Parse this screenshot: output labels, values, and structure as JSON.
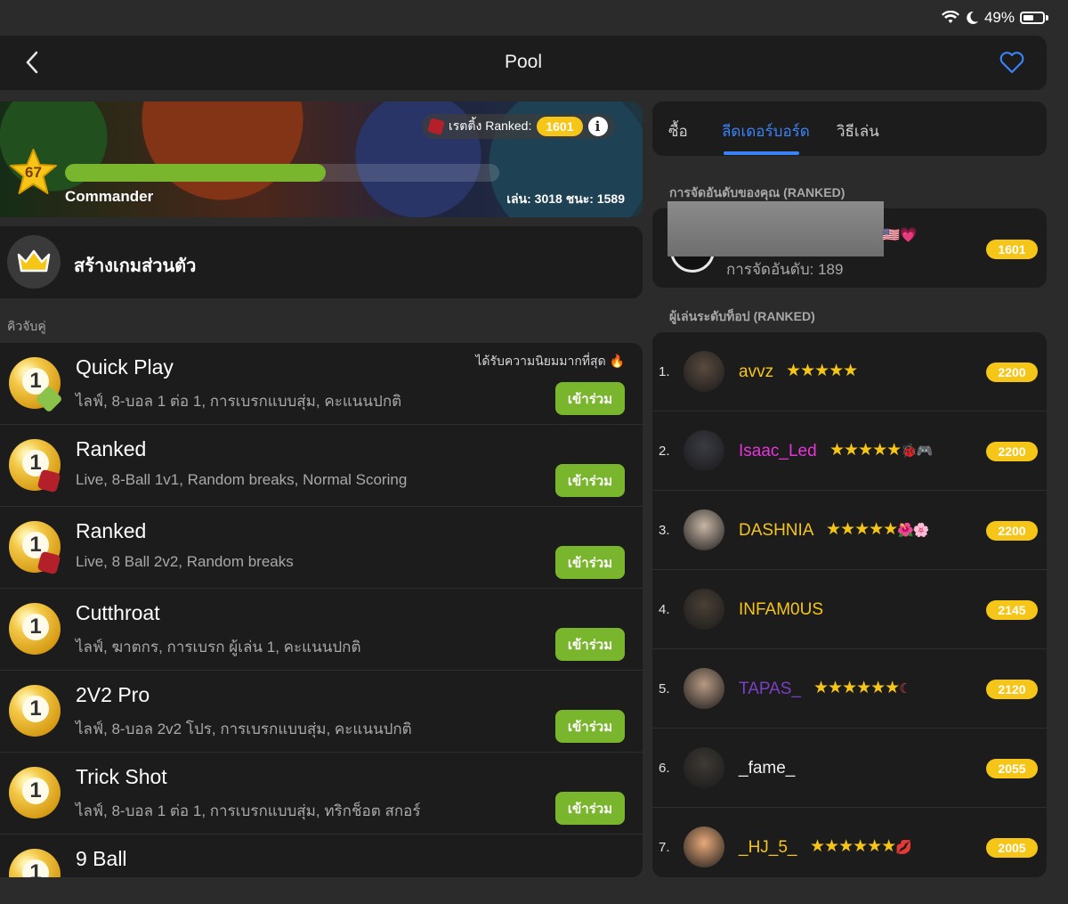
{
  "status": {
    "battery": "49%"
  },
  "header": {
    "title": "Pool"
  },
  "banner": {
    "rating_label": "เรตติ้ง Ranked:",
    "rating_value": "1601",
    "level": "67",
    "xp_progress": 0.6,
    "rank_title": "Commander",
    "stats": "เล่น: 3018 ชนะ: 1589"
  },
  "private_game": {
    "label": "สร้างเกมส่วนตัว"
  },
  "queue_heading": "คิวจับคู่",
  "games": [
    {
      "title": "Quick Play",
      "desc": "ไลฟ์, 8-บอล 1 ต่อ 1, การเบรกแบบสุ่ม, คะแนนปกติ",
      "badge": "bolt",
      "popular": "ได้รับความนิยมมากที่สุด",
      "join": "เข้าร่วม"
    },
    {
      "title": "Ranked",
      "desc": "Live, 8-Ball 1v1, Random breaks, Normal Scoring",
      "badge": "dice",
      "join": "เข้าร่วม"
    },
    {
      "title": "Ranked",
      "desc": "Live, 8 Ball 2v2, Random breaks",
      "badge": "dice",
      "join": "เข้าร่วม"
    },
    {
      "title": "Cutthroat",
      "desc": "ไลฟ์, ฆาตกร, การเบรก ผู้เล่น  1, คะแนนปกติ",
      "badge": "",
      "join": "เข้าร่วม"
    },
    {
      "title": "2V2 Pro",
      "desc": "ไลฟ์, 8-บอล 2v2 โปร, การเบรกแบบสุ่ม, คะแนนปกติ",
      "badge": "",
      "join": "เข้าร่วม"
    },
    {
      "title": "Trick Shot",
      "desc": "ไลฟ์, 8-บอล 1 ต่อ 1, การเบรกแบบสุ่ม, ทริกช็อต สกอร์",
      "badge": "",
      "join": "เข้าร่วม"
    },
    {
      "title": "9 Ball",
      "desc": "",
      "badge": "",
      "join": ""
    }
  ],
  "tabs": [
    "ซื้อ",
    "ลีดเดอร์บอร์ด",
    "วิธีเล่น"
  ],
  "my_rank": {
    "heading": "การจัดอันดับของคุณ (RANKED)",
    "rank_text": "การจัดอันดับ: 189",
    "score": "1601"
  },
  "top_heading": "ผู้เล่นระดับท็อป (RANKED)",
  "leaders": [
    {
      "rank": "1.",
      "name": "avvz",
      "color": "#f5c518",
      "stars": "★★★★★",
      "extra": "",
      "score": "2200"
    },
    {
      "rank": "2.",
      "name": "Isaac_Led",
      "color": "#e535d8",
      "stars": "★★★★★",
      "extra": "🐞🎮",
      "score": "2200"
    },
    {
      "rank": "3.",
      "name": "DASHNIA",
      "color": "#f5c518",
      "stars": "★★★★★",
      "extra": "🌺🌸",
      "score": "2200"
    },
    {
      "rank": "4.",
      "name": "INFAM0US",
      "color": "#f5c518",
      "stars": "",
      "extra": "",
      "score": "2145"
    },
    {
      "rank": "5.",
      "name": "TAPAS_",
      "color": "#7b3fc4",
      "stars": "★★★★★★",
      "extra": "☾",
      "score": "2120"
    },
    {
      "rank": "6.",
      "name": "_fame_",
      "color": "#f0f0f0",
      "stars": "",
      "extra": "",
      "score": "2055"
    },
    {
      "rank": "7.",
      "name": "_HJ_5_",
      "color": "#f5c518",
      "stars": "★★★★★★",
      "extra": "💋",
      "score": "2005"
    }
  ]
}
